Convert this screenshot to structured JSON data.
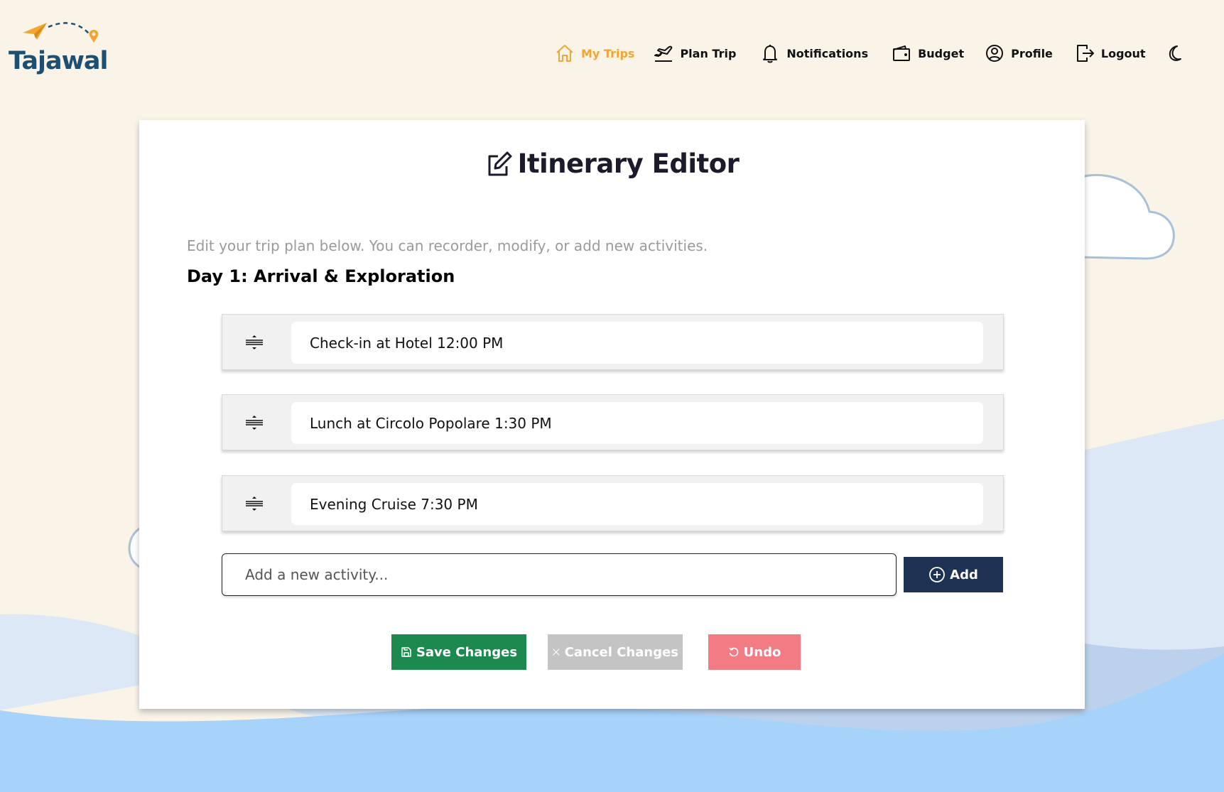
{
  "brand": {
    "name": "Tajawal",
    "primary_color": "#1d4f73",
    "accent_color": "#f2a531"
  },
  "nav": {
    "items": [
      {
        "label": "My Trips",
        "icon": "home-icon",
        "active": true
      },
      {
        "label": "Plan Trip",
        "icon": "airplane-takeoff-icon",
        "active": false
      },
      {
        "label": "Notifications",
        "icon": "bell-icon",
        "active": false
      },
      {
        "label": "Budget",
        "icon": "wallet-icon",
        "active": false
      },
      {
        "label": "Profile",
        "icon": "user-circle-icon",
        "active": false
      },
      {
        "label": "Logout",
        "icon": "logout-icon",
        "active": false
      }
    ],
    "theme_toggle_icon": "moon-icon"
  },
  "editor": {
    "title": "Itinerary Editor",
    "title_icon": "edit-icon",
    "subtitle": "Edit your trip plan below. You can recorder, modify, or add new activities.",
    "day_title": "Day 1: Arrival & Exploration",
    "activities": [
      {
        "text": "Check-in at Hotel 12:00 PM"
      },
      {
        "text": "Lunch at Circolo Popolare 1:30 PM"
      },
      {
        "text": "Evening Cruise 7:30 PM"
      }
    ],
    "new_activity_placeholder": "Add a new activity...",
    "add_label": "Add",
    "save_label": "Save Changes",
    "cancel_label": "Cancel Changes",
    "undo_label": "Undo"
  },
  "colors": {
    "page_bg": "#faf3e8",
    "add_button": "#1e3354",
    "save_button": "#1c8a4f",
    "cancel_button": "#c4c4c4",
    "undo_button": "#f27b84",
    "wave_light": "#dce8f6",
    "wave_mid": "#bcd1ec",
    "wave_front": "#a7d3fb"
  }
}
